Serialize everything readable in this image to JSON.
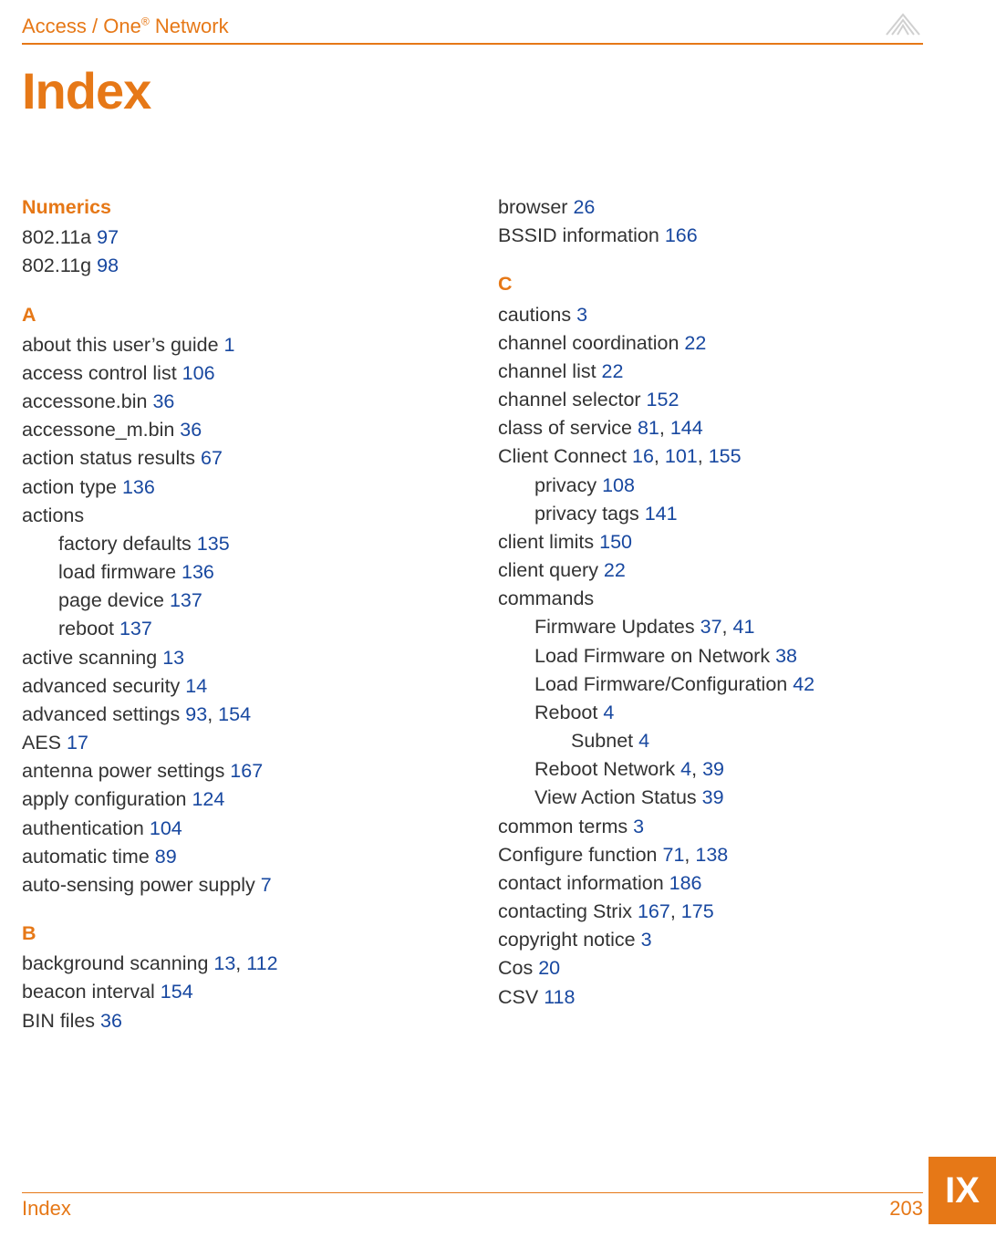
{
  "header": {
    "title_prefix": "Access / One",
    "title_suffix": " Network"
  },
  "heading": "Index",
  "left": {
    "numerics": {
      "head": "Numerics",
      "items": [
        {
          "text": "802.11a ",
          "pg": "97"
        },
        {
          "text": "802.11g ",
          "pg": "98"
        }
      ]
    },
    "a": {
      "head": "A",
      "items": [
        {
          "text": "about this user’s guide ",
          "pg": "1"
        },
        {
          "text": "access control list ",
          "pg": "106"
        },
        {
          "text": "accessone.bin ",
          "pg": "36"
        },
        {
          "text": "accessone_m.bin ",
          "pg": "36"
        },
        {
          "text": "action status results ",
          "pg": "67"
        },
        {
          "text": "action type ",
          "pg": "136"
        },
        {
          "text": "actions",
          "pg": ""
        },
        {
          "text": "factory defaults ",
          "pg": "135",
          "indent": 1
        },
        {
          "text": "load firmware ",
          "pg": "136",
          "indent": 1
        },
        {
          "text": "page device ",
          "pg": "137",
          "indent": 1
        },
        {
          "text": "reboot ",
          "pg": "137",
          "indent": 1
        },
        {
          "text": "active scanning ",
          "pg": "13"
        },
        {
          "text": "advanced security ",
          "pg": "14"
        },
        {
          "text": "advanced settings ",
          "pg": "93",
          "pg2": "154"
        },
        {
          "text": "AES ",
          "pg": "17"
        },
        {
          "text": "antenna power settings ",
          "pg": "167"
        },
        {
          "text": "apply configuration ",
          "pg": "124"
        },
        {
          "text": "authentication ",
          "pg": "104"
        },
        {
          "text": "automatic time ",
          "pg": "89"
        },
        {
          "text": "auto-sensing power supply ",
          "pg": "7"
        }
      ]
    },
    "b": {
      "head": "B",
      "items": [
        {
          "text": "background scanning ",
          "pg": "13",
          "pg2": "112"
        },
        {
          "text": "beacon interval ",
          "pg": "154"
        },
        {
          "text": "BIN files ",
          "pg": "36"
        }
      ]
    }
  },
  "right": {
    "pre": [
      {
        "text": "browser ",
        "pg": "26"
      },
      {
        "text": "BSSID information ",
        "pg": "166"
      }
    ],
    "c": {
      "head": "C",
      "items": [
        {
          "text": "cautions ",
          "pg": "3"
        },
        {
          "text": "channel coordination ",
          "pg": "22"
        },
        {
          "text": "channel list ",
          "pg": "22"
        },
        {
          "text": "channel selector ",
          "pg": "152"
        },
        {
          "text": "class of service ",
          "pg": "81",
          "pg2": "144"
        },
        {
          "text": "Client Connect ",
          "pg": "16",
          "pg2": "101",
          "pg3": "155"
        },
        {
          "text": "privacy ",
          "pg": "108",
          "indent": 1
        },
        {
          "text": "privacy tags ",
          "pg": "141",
          "indent": 1
        },
        {
          "text": "client limits ",
          "pg": "150"
        },
        {
          "text": "client query ",
          "pg": "22"
        },
        {
          "text": "commands",
          "pg": ""
        },
        {
          "text": "Firmware Updates ",
          "pg": "37",
          "pg2": "41",
          "indent": 1
        },
        {
          "text": "Load Firmware on Network ",
          "pg": "38",
          "indent": 1
        },
        {
          "text": "Load Firmware/Configuration ",
          "pg": "42",
          "indent": 1
        },
        {
          "text": "Reboot ",
          "pg": "4",
          "indent": 1
        },
        {
          "text": "Subnet ",
          "pg": "4",
          "indent": 2
        },
        {
          "text": "Reboot Network ",
          "pg": "4",
          "pg2": "39",
          "indent": 1
        },
        {
          "text": "View Action Status ",
          "pg": "39",
          "indent": 1
        },
        {
          "text": "common terms ",
          "pg": "3"
        },
        {
          "text": "Configure function ",
          "pg": "71",
          "pg2": "138"
        },
        {
          "text": "contact information ",
          "pg": "186"
        },
        {
          "text": "contacting Strix ",
          "pg": "167",
          "pg2": "175"
        },
        {
          "text": "copyright notice ",
          "pg": "3"
        },
        {
          "text": "Cos ",
          "pg": "20"
        },
        {
          "text": "CSV ",
          "pg": "118"
        }
      ]
    }
  },
  "footer": {
    "label": "Index",
    "page": "203"
  },
  "tab": "IX"
}
